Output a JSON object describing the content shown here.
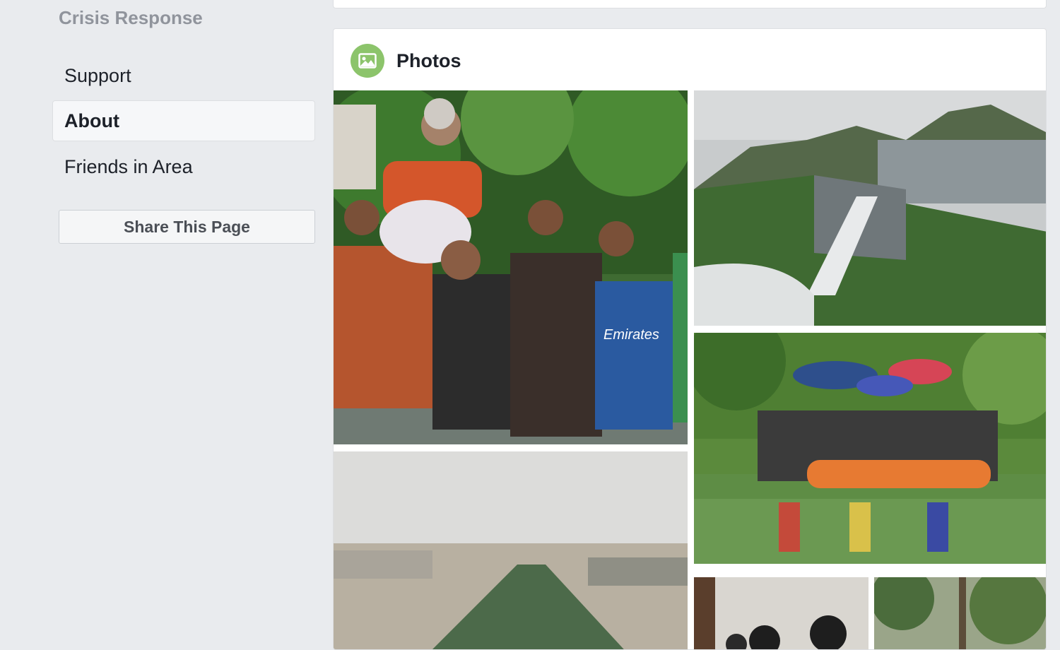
{
  "sidebar": {
    "title": "Crisis Response",
    "items": [
      {
        "label": "Support",
        "active": false
      },
      {
        "label": "About",
        "active": true
      },
      {
        "label": "Friends in Area",
        "active": false
      }
    ],
    "share_button": "Share This Page"
  },
  "photos": {
    "title": "Photos",
    "icon": "photo-icon",
    "accent_color": "#8cc46b",
    "images": [
      {
        "name": "photo-flood-rescue-elderly-woman",
        "jersey_text": "Emirates"
      },
      {
        "name": "photo-dam-spillway"
      },
      {
        "name": "photo-rescue-boat-umbrellas"
      },
      {
        "name": "photo-aerial-flooded-city"
      },
      {
        "name": "photo-people-indoors"
      },
      {
        "name": "photo-trees-outdoors"
      }
    ]
  }
}
